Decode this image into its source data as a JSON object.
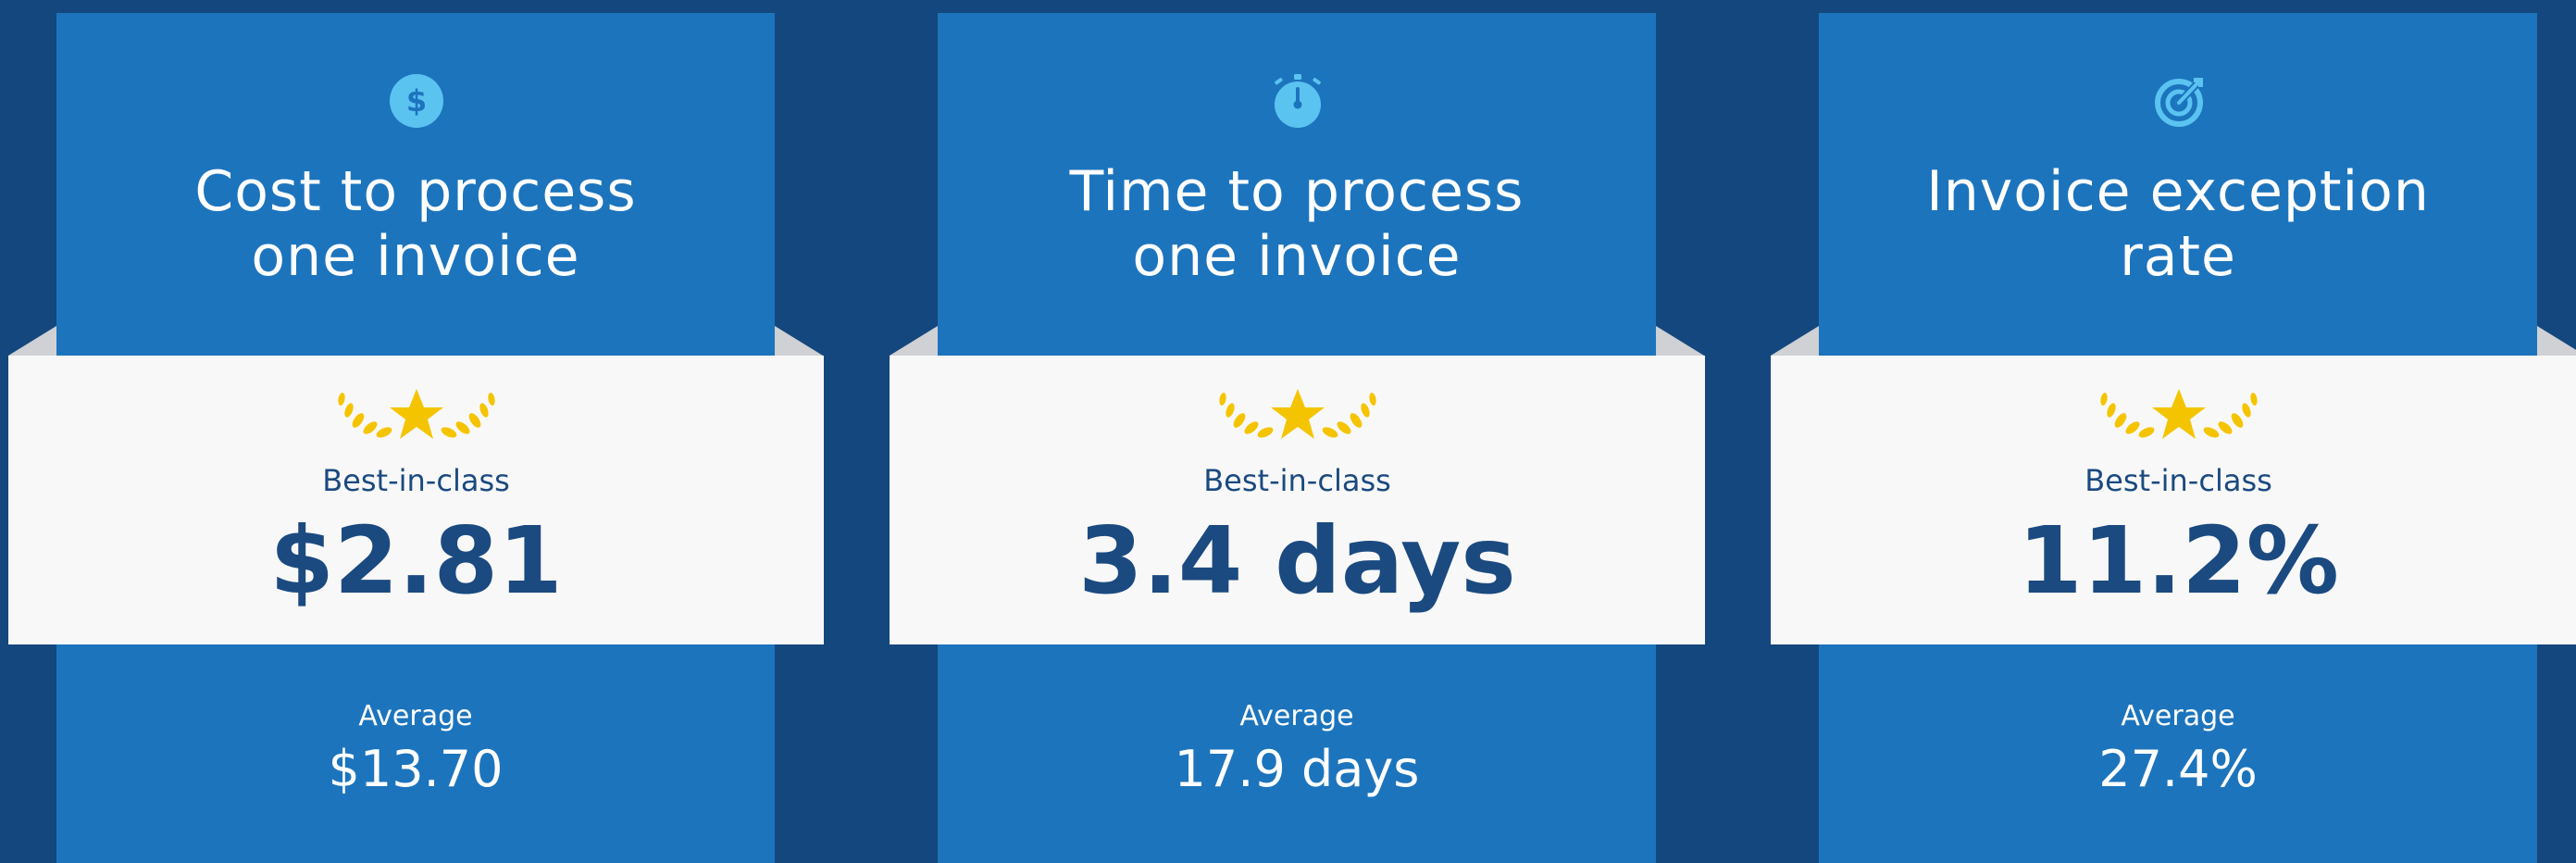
{
  "colors": {
    "background": "#14477d",
    "card": "#1c74bd",
    "band": "#f8f8f8",
    "accent_text": "#1b4a80",
    "star": "#f5c400",
    "icon": "#5bc3f0"
  },
  "cards": [
    {
      "icon": "dollar-coin-icon",
      "title_line1": "Cost to process",
      "title_line2": "one invoice",
      "best_label": "Best-in-class",
      "best_value": "$2.81",
      "avg_label": "Average",
      "avg_value": "$13.70"
    },
    {
      "icon": "stopwatch-icon",
      "title_line1": "Time to process",
      "title_line2": "one invoice",
      "best_label": "Best-in-class",
      "best_value": "3.4 days",
      "avg_label": "Average",
      "avg_value": "17.9 days"
    },
    {
      "icon": "target-icon",
      "title_line1": "Invoice exception",
      "title_line2": "rate",
      "best_label": "Best-in-class",
      "best_value": "11.2%",
      "avg_label": "Average",
      "avg_value": "27.4%"
    }
  ]
}
